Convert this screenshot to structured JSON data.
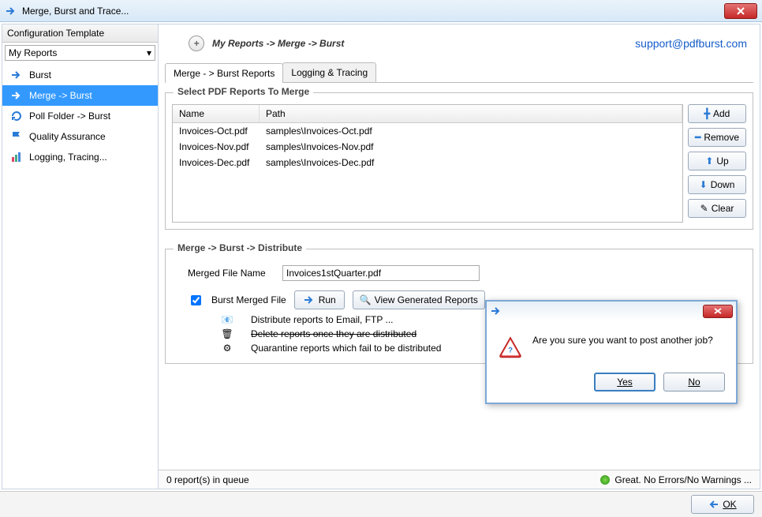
{
  "window": {
    "title": "Merge, Burst and Trace..."
  },
  "sidebar": {
    "header": "Configuration Template",
    "dropdown": "My Reports",
    "items": [
      {
        "label": "Burst",
        "icon": "arrow-right-icon"
      },
      {
        "label": "Merge -> Burst",
        "icon": "arrow-right-icon"
      },
      {
        "label": "Poll Folder -> Burst",
        "icon": "refresh-icon"
      },
      {
        "label": "Quality Assurance",
        "icon": "flag-icon"
      },
      {
        "label": "Logging, Tracing...",
        "icon": "chart-icon"
      }
    ],
    "selected_index": 1
  },
  "header": {
    "breadcrumb": "My Reports -> Merge -> Burst",
    "support": "support@pdfburst.com"
  },
  "tabs": [
    {
      "label": "Merge - > Burst Reports",
      "active": true
    },
    {
      "label": "Logging & Tracing",
      "active": false
    }
  ],
  "merge_group": {
    "legend": "Select PDF Reports To Merge",
    "columns": {
      "name": "Name",
      "path": "Path"
    },
    "files": [
      {
        "name": "Invoices-Oct.pdf",
        "path": "samples\\Invoices-Oct.pdf"
      },
      {
        "name": "Invoices-Nov.pdf",
        "path": "samples\\Invoices-Nov.pdf"
      },
      {
        "name": "Invoices-Dec.pdf",
        "path": "samples\\Invoices-Dec.pdf"
      }
    ],
    "buttons": {
      "add": "Add",
      "remove": "Remove",
      "up": "Up",
      "down": "Down",
      "clear": "Clear"
    }
  },
  "dist_group": {
    "legend": "Merge -> Burst -> Distribute",
    "merged_label": "Merged File Name",
    "merged_value": "Invoices1stQuarter.pdf",
    "burst_checkbox_label": "Burst Merged File",
    "burst_checked": true,
    "run": "Run",
    "view_reports": "View Generated Reports",
    "rows": [
      {
        "icon": "mail-icon",
        "text": "Distribute reports to Email, FTP ...",
        "strike": false
      },
      {
        "icon": "trash-icon",
        "text": "Delete reports once they are distributed",
        "strike": true
      },
      {
        "icon": "quarantine-icon",
        "text": "Quarantine reports which fail to be distributed",
        "strike": false
      }
    ]
  },
  "status": {
    "left": "0 report(s) in queue",
    "right": "Great. No Errors/No Warnings ..."
  },
  "ok_button": "OK",
  "dialog": {
    "message": "Are you sure you want to post another job?",
    "yes": "Yes",
    "no": "No"
  }
}
